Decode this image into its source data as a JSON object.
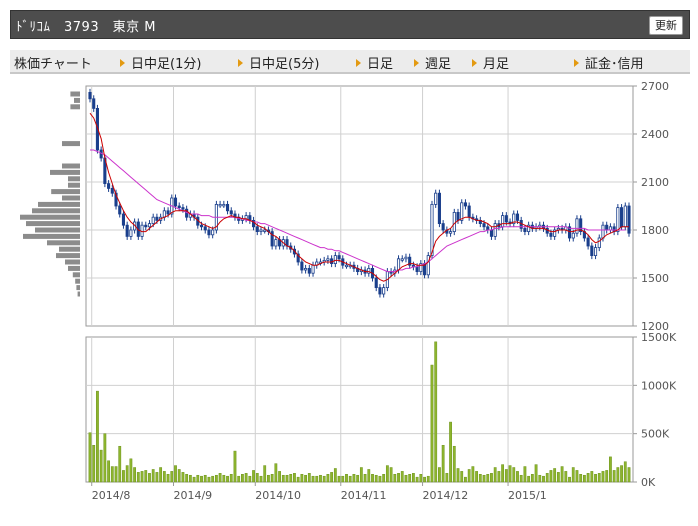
{
  "header": {
    "title": "ﾄﾞﾘｺﾑ　3793　東京 M",
    "refresh_label": "更新"
  },
  "tabs": [
    {
      "label": "株価チャート",
      "link": false,
      "arrow": false
    },
    {
      "label": "日中足(1分)",
      "link": true,
      "arrow": true
    },
    {
      "label": "日中足(5分)",
      "link": true,
      "arrow": true
    },
    {
      "label": "日足",
      "link": false,
      "arrow": true
    },
    {
      "label": "週足",
      "link": true,
      "arrow": true
    },
    {
      "label": "月足",
      "link": true,
      "arrow": true
    },
    {
      "label": "証金･信用",
      "link": true,
      "arrow": true
    }
  ],
  "colors": {
    "candle": "#1a3f8c",
    "ma_short": "#cc0000",
    "ma_long": "#cc33cc",
    "volume": "#8db52d",
    "volume_edge": "#6f9420",
    "profile": "#8c8c8c",
    "grid": "#d0d0d0"
  },
  "chart_data": [
    {
      "type": "candlestick",
      "yticks": [
        "2700",
        "2400",
        "2100",
        "1800",
        "1500",
        "1200"
      ],
      "ylim": [
        1200,
        2700
      ],
      "xticks": [
        "2014/8",
        "2014/9",
        "2014/10",
        "2014/11",
        "2014/12",
        "2015/1"
      ],
      "close": [
        2620,
        2560,
        2300,
        2250,
        2090,
        2060,
        2030,
        1950,
        1900,
        1830,
        1760,
        1800,
        1850,
        1760,
        1830,
        1820,
        1840,
        1880,
        1860,
        1880,
        1920,
        1900,
        2000,
        1950,
        1940,
        1930,
        1880,
        1900,
        1880,
        1830,
        1820,
        1800,
        1770,
        1800,
        1960,
        1960,
        1960,
        1920,
        1900,
        1880,
        1860,
        1870,
        1890,
        1860,
        1820,
        1790,
        1800,
        1800,
        1790,
        1700,
        1740,
        1700,
        1740,
        1700,
        1680,
        1650,
        1600,
        1550,
        1560,
        1530,
        1580,
        1600,
        1600,
        1610,
        1620,
        1590,
        1640,
        1620,
        1580,
        1580,
        1580,
        1560,
        1540,
        1550,
        1530,
        1560,
        1500,
        1440,
        1400,
        1440,
        1540,
        1530,
        1550,
        1620,
        1620,
        1630,
        1580,
        1570,
        1540,
        1590,
        1520,
        1640,
        1960,
        2030,
        1840,
        1800,
        1780,
        1790,
        1910,
        1860,
        1970,
        1950,
        1880,
        1870,
        1860,
        1840,
        1820,
        1800,
        1760,
        1840,
        1820,
        1890,
        1850,
        1840,
        1900,
        1860,
        1810,
        1790,
        1830,
        1810,
        1820,
        1830,
        1810,
        1780,
        1760,
        1800,
        1810,
        1800,
        1820,
        1750,
        1780,
        1870,
        1790,
        1750,
        1700,
        1640,
        1690,
        1750,
        1830,
        1800,
        1820,
        1790,
        1940,
        1820,
        1950,
        1780
      ],
      "ma_short": [
        2530,
        2500,
        2440,
        2370,
        2250,
        2160,
        2090,
        2020,
        1970,
        1920,
        1880,
        1850,
        1830,
        1800,
        1790,
        1790,
        1810,
        1830,
        1850,
        1870,
        1880,
        1890,
        1910,
        1920,
        1920,
        1920,
        1920,
        1900,
        1880,
        1860,
        1840,
        1830,
        1820,
        1810,
        1820,
        1850,
        1870,
        1880,
        1890,
        1880,
        1880,
        1870,
        1870,
        1860,
        1850,
        1830,
        1820,
        1810,
        1790,
        1770,
        1760,
        1740,
        1720,
        1700,
        1690,
        1670,
        1640,
        1620,
        1600,
        1590,
        1580,
        1580,
        1590,
        1600,
        1600,
        1600,
        1610,
        1610,
        1600,
        1590,
        1580,
        1570,
        1560,
        1550,
        1540,
        1540,
        1530,
        1510,
        1490,
        1480,
        1490,
        1510,
        1530,
        1550,
        1570,
        1580,
        1590,
        1590,
        1580,
        1580,
        1580,
        1600,
        1660,
        1730,
        1760,
        1780,
        1800,
        1810,
        1840,
        1860,
        1870,
        1880,
        1880,
        1870,
        1860,
        1860,
        1850,
        1840,
        1820,
        1820,
        1830,
        1840,
        1840,
        1840,
        1850,
        1850,
        1840,
        1830,
        1820,
        1810,
        1810,
        1810,
        1810,
        1800,
        1790,
        1790,
        1800,
        1800,
        1800,
        1790,
        1790,
        1800,
        1800,
        1790,
        1770,
        1740,
        1720,
        1730,
        1750,
        1770,
        1780,
        1790,
        1800,
        1820,
        1820,
        1820
      ],
      "ma_long": [
        2300,
        2300,
        2290,
        2280,
        2270,
        2250,
        2230,
        2210,
        2190,
        2170,
        2150,
        2130,
        2110,
        2090,
        2070,
        2050,
        2030,
        2010,
        1990,
        1980,
        1970,
        1960,
        1950,
        1940,
        1930,
        1920,
        1910,
        1900,
        1900,
        1900,
        1890,
        1890,
        1890,
        1880,
        1880,
        1880,
        1880,
        1880,
        1880,
        1880,
        1870,
        1870,
        1860,
        1860,
        1850,
        1850,
        1840,
        1840,
        1830,
        1820,
        1810,
        1800,
        1790,
        1780,
        1770,
        1760,
        1750,
        1740,
        1730,
        1720,
        1710,
        1700,
        1690,
        1690,
        1680,
        1680,
        1670,
        1670,
        1660,
        1650,
        1640,
        1630,
        1620,
        1610,
        1600,
        1590,
        1580,
        1570,
        1560,
        1550,
        1540,
        1540,
        1540,
        1550,
        1550,
        1560,
        1560,
        1570,
        1570,
        1580,
        1590,
        1600,
        1620,
        1640,
        1660,
        1680,
        1700,
        1710,
        1720,
        1730,
        1740,
        1750,
        1760,
        1770,
        1780,
        1790,
        1790,
        1800,
        1800,
        1810,
        1810,
        1820,
        1820,
        1820,
        1820,
        1820,
        1820,
        1820,
        1820,
        1820,
        1820,
        1820,
        1820,
        1820,
        1820,
        1820,
        1820,
        1820,
        1820,
        1810,
        1810,
        1810,
        1810,
        1810,
        1800,
        1800,
        1800,
        1800,
        1800,
        1800,
        1800,
        1800,
        1800,
        1800,
        1800
      ],
      "price_volume_profile": [
        {
          "price": 2650,
          "rel": 0.16
        },
        {
          "price": 2610,
          "rel": 0.1
        },
        {
          "price": 2570,
          "rel": 0.16
        },
        {
          "price": 2340,
          "rel": 0.3
        },
        {
          "price": 2200,
          "rel": 0.3
        },
        {
          "price": 2160,
          "rel": 0.5
        },
        {
          "price": 2120,
          "rel": 0.2
        },
        {
          "price": 2080,
          "rel": 0.2
        },
        {
          "price": 2040,
          "rel": 0.48
        },
        {
          "price": 2000,
          "rel": 0.3
        },
        {
          "price": 1960,
          "rel": 0.7
        },
        {
          "price": 1920,
          "rel": 0.8
        },
        {
          "price": 1880,
          "rel": 1.0
        },
        {
          "price": 1840,
          "rel": 0.9
        },
        {
          "price": 1800,
          "rel": 0.75
        },
        {
          "price": 1760,
          "rel": 0.95
        },
        {
          "price": 1720,
          "rel": 0.55
        },
        {
          "price": 1680,
          "rel": 0.35
        },
        {
          "price": 1640,
          "rel": 0.4
        },
        {
          "price": 1600,
          "rel": 0.25
        },
        {
          "price": 1560,
          "rel": 0.2
        },
        {
          "price": 1520,
          "rel": 0.12
        },
        {
          "price": 1480,
          "rel": 0.08
        },
        {
          "price": 1440,
          "rel": 0.06
        },
        {
          "price": 1400,
          "rel": 0.04
        }
      ]
    },
    {
      "type": "bar",
      "yticks": [
        "1500K",
        "1000K",
        "500K",
        "0K"
      ],
      "ylim": [
        0,
        1500000
      ],
      "values": [
        510000,
        380000,
        940000,
        330000,
        500000,
        220000,
        160000,
        160000,
        370000,
        120000,
        170000,
        240000,
        150000,
        100000,
        110000,
        120000,
        90000,
        130000,
        100000,
        150000,
        110000,
        80000,
        110000,
        170000,
        130000,
        100000,
        80000,
        70000,
        50000,
        70000,
        60000,
        70000,
        50000,
        60000,
        70000,
        90000,
        70000,
        60000,
        80000,
        320000,
        60000,
        80000,
        90000,
        60000,
        120000,
        90000,
        60000,
        170000,
        70000,
        80000,
        190000,
        110000,
        70000,
        70000,
        80000,
        90000,
        50000,
        80000,
        70000,
        90000,
        60000,
        60000,
        70000,
        60000,
        80000,
        100000,
        140000,
        60000,
        60000,
        80000,
        60000,
        80000,
        70000,
        150000,
        80000,
        130000,
        80000,
        70000,
        60000,
        80000,
        170000,
        150000,
        80000,
        90000,
        110000,
        70000,
        80000,
        90000,
        50000,
        80000,
        50000,
        60000,
        1210000,
        1450000,
        150000,
        380000,
        90000,
        620000,
        370000,
        140000,
        110000,
        50000,
        130000,
        160000,
        110000,
        80000,
        70000,
        80000,
        90000,
        150000,
        110000,
        180000,
        130000,
        170000,
        150000,
        110000,
        70000,
        160000,
        60000,
        80000,
        180000,
        70000,
        60000,
        90000,
        120000,
        140000,
        100000,
        160000,
        110000,
        50000,
        150000,
        120000,
        80000,
        70000,
        90000,
        110000,
        80000,
        90000,
        110000,
        120000,
        260000,
        120000,
        150000,
        170000,
        210000,
        150000
      ]
    }
  ]
}
